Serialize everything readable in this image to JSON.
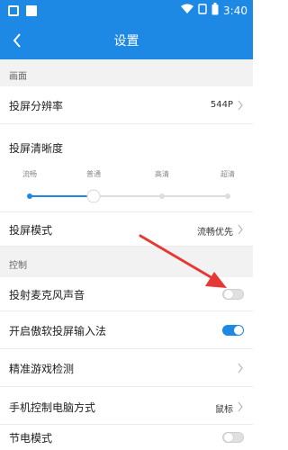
{
  "status_bar": {
    "time": "3:40"
  },
  "header": {
    "title": "设置"
  },
  "sections": {
    "picture": "画面",
    "control": "控制"
  },
  "resolution": {
    "label": "投屏分辨率",
    "value": "544P"
  },
  "clarity": {
    "label": "投屏清晰度",
    "options": [
      "流畅",
      "普通",
      "高清",
      "超清"
    ],
    "selected_index": 1
  },
  "mode": {
    "label": "投屏模式",
    "value": "流畅优先"
  },
  "mic": {
    "label": "投射麦克风声音",
    "on": false
  },
  "ime": {
    "label": "开启傲软投屏输入法",
    "on": true
  },
  "game_detect": {
    "label": "精准游戏检测"
  },
  "phone_control": {
    "label": "手机控制电脑方式",
    "value": "鼠标"
  },
  "power_save": {
    "label": "节电模式",
    "on": false
  },
  "colors": {
    "accent": "#1e88e5",
    "arrow": "#e53935"
  }
}
